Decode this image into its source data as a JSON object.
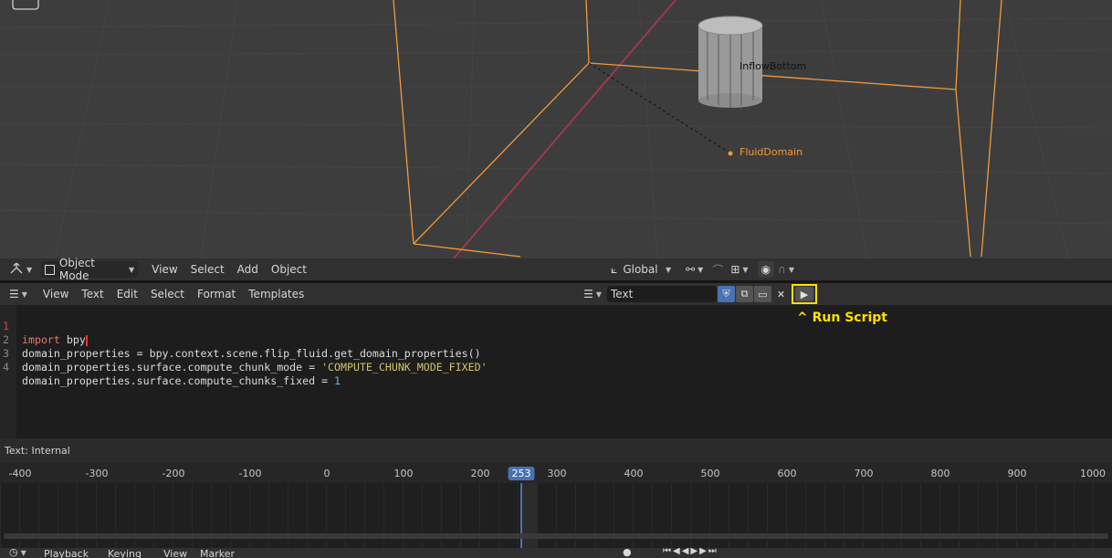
{
  "viewport": {
    "objects": [
      {
        "label": "InflowBottom"
      },
      {
        "label": "FluidDomain"
      }
    ],
    "header": {
      "mode": "Object Mode",
      "menus": [
        "View",
        "Select",
        "Add",
        "Object"
      ],
      "orientation": "Global"
    }
  },
  "text_editor": {
    "menus": [
      "View",
      "Text",
      "Edit",
      "Select",
      "Format",
      "Templates"
    ],
    "datablock_name": "Text",
    "run_script_hint": "^ Run Script",
    "lines": [
      {
        "n": "1",
        "parts": [
          {
            "t": "import",
            "c": "kw"
          },
          {
            "t": " bpy",
            "c": ""
          }
        ]
      },
      {
        "n": "2",
        "parts": [
          {
            "t": "domain_properties = bpy.context.scene.flip_fluid.get_domain_properties()",
            "c": ""
          }
        ]
      },
      {
        "n": "3",
        "parts": [
          {
            "t": "domain_properties.surface.compute_chunk_mode = ",
            "c": ""
          },
          {
            "t": "'COMPUTE_CHUNK_MODE_FIXED'",
            "c": "str"
          }
        ]
      },
      {
        "n": "4",
        "parts": [
          {
            "t": "domain_properties.surface.compute_chunks_fixed = ",
            "c": ""
          },
          {
            "t": "1",
            "c": "num"
          }
        ]
      }
    ],
    "status": "Text: Internal"
  },
  "timeline": {
    "ticks": [
      "-400",
      "-300",
      "-200",
      "-100",
      "0",
      "100",
      "200",
      "300",
      "400",
      "500",
      "600",
      "700",
      "800",
      "900",
      "1000"
    ],
    "current_frame": "253",
    "footer_menus": [
      "Playback",
      "Keying",
      "View",
      "Marker"
    ]
  },
  "colors": {
    "selection_orange": "#f29a3a",
    "x_axis_red": "#9e3a4c",
    "highlight_yellow": "#ffe000",
    "frame_blue": "#4772b3"
  }
}
